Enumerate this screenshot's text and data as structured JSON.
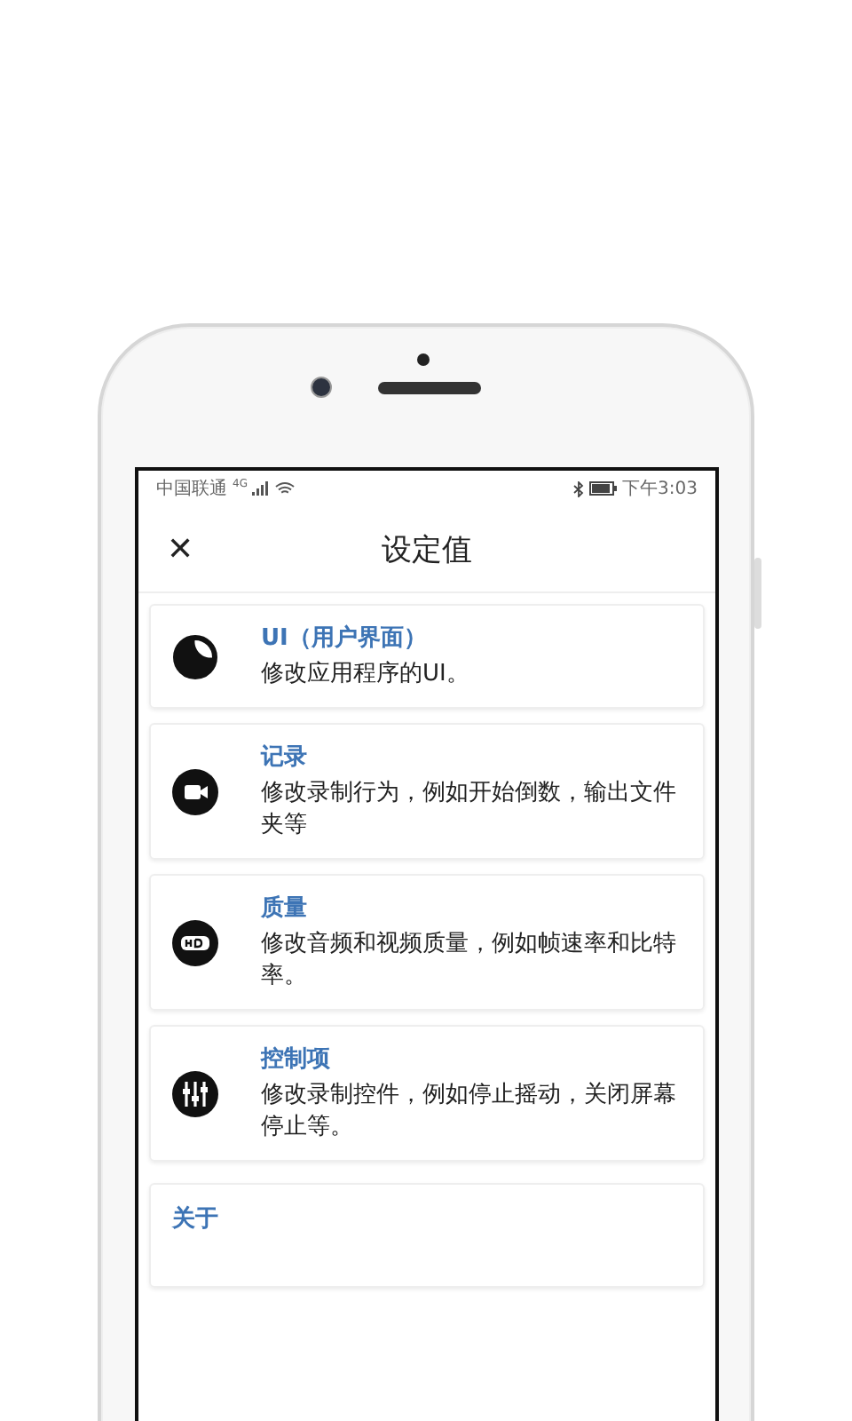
{
  "status_bar": {
    "carrier": "中国联通",
    "signal_label": "4G",
    "time": "下午3:03"
  },
  "header": {
    "close": "✕",
    "title": "设定值"
  },
  "items": [
    {
      "kind": "setting",
      "title": "UI（用户界面）",
      "description": "修改应用程序的UI。"
    },
    {
      "kind": "setting",
      "title": "记录",
      "description": "修改录制行为，例如开始倒数，输出文件夹等"
    },
    {
      "kind": "setting",
      "title": "质量",
      "description": "修改音频和视频质量，例如帧速率和比特率。"
    },
    {
      "kind": "setting",
      "title": "控制项",
      "description": "修改录制控件，例如停止摇动，关闭屏幕停止等。"
    },
    {
      "kind": "link",
      "title": "关于"
    }
  ]
}
